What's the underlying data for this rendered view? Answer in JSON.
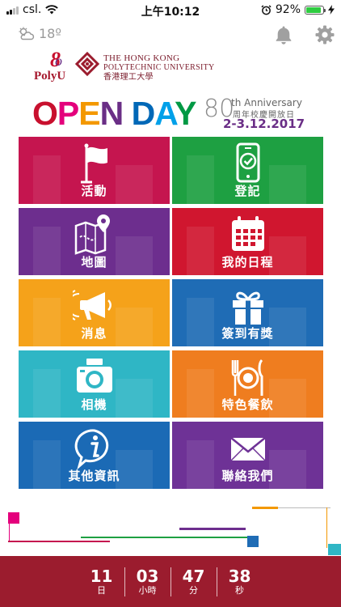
{
  "status_bar": {
    "carrier": "csl.",
    "time": "上午10:12",
    "battery_percent": "92%",
    "battery_level": 0.92
  },
  "weather": {
    "temperature": "18º",
    "icon": "partly-cloudy-icon"
  },
  "header_icons": [
    "bell-icon",
    "gear-icon"
  ],
  "logos": {
    "polyu": "PolyU",
    "hk_line1": "The Hong Kong",
    "hk_line2": "Polytechnic University",
    "hk_line3": "香港理工大學"
  },
  "banner": {
    "title_letters": [
      "O",
      "P",
      "E",
      "N",
      " ",
      "D",
      "A",
      "Y"
    ],
    "title_colors": [
      "#c8102e",
      "#e4007c",
      "#f39800",
      "#6a2e86",
      "",
      "#0068b7",
      "#00a0e9",
      "#009944"
    ],
    "anniversary_number": "80",
    "anniversary_text": "th Anniversary",
    "anniversary_zh": "周年校慶開放日",
    "dates": "2-3.12.2017"
  },
  "tiles": [
    {
      "label": "活動",
      "icon": "flag-icon",
      "color": "#c5154f"
    },
    {
      "label": "登記",
      "icon": "phone-check-icon",
      "color": "#1ea042"
    },
    {
      "label": "地圖",
      "icon": "map-pin-icon",
      "color": "#6d2e8e"
    },
    {
      "label": "我的日程",
      "icon": "calendar-icon",
      "color": "#d0162f"
    },
    {
      "label": "消息",
      "icon": "megaphone-icon",
      "color": "#f5a21a"
    },
    {
      "label": "簽到有獎",
      "icon": "gift-icon",
      "color": "#1f6cb5"
    },
    {
      "label": "相機",
      "icon": "camera-icon",
      "color": "#2fb6c5"
    },
    {
      "label": "特色餐飲",
      "icon": "dining-icon",
      "color": "#ef7d1f"
    },
    {
      "label": "其他資訊",
      "icon": "info-icon",
      "color": "#1b6ab5"
    },
    {
      "label": "聯絡我們",
      "icon": "mail-icon",
      "color": "#6e3296"
    }
  ],
  "countdown": [
    {
      "value": "11",
      "unit": "日"
    },
    {
      "value": "03",
      "unit": "小時"
    },
    {
      "value": "47",
      "unit": "分"
    },
    {
      "value": "38",
      "unit": "秒"
    }
  ]
}
